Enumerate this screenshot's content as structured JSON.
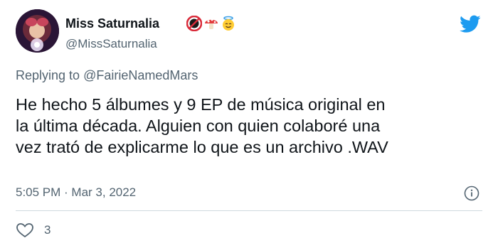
{
  "author": {
    "display_name": "Miss Saturnalia",
    "handle": "@MissSaturnalia",
    "badges": [
      "18-plus-emoji",
      "mushroom-emoji",
      "smiling-halo-emoji"
    ]
  },
  "reply": {
    "prefix": "Replying to ",
    "mention": "@FairieNamedMars"
  },
  "tweet": {
    "lines": [
      "He hecho 5 álbumes y 9 EP de música original en",
      "la última década. Alguien con quien colaboré una",
      "vez trató de explicarme lo que es un archivo .WAV"
    ]
  },
  "meta": {
    "timestamp": "5:05 PM · Mar 3, 2022"
  },
  "actions": {
    "like_count": "3"
  },
  "icons": {
    "logo": "twitter-bird-icon",
    "info": "info-icon",
    "like": "heart-icon"
  },
  "colors": {
    "brand": "#1d9bf0",
    "text": "#0f1419",
    "muted": "#536471",
    "divider": "#cfd9de"
  }
}
